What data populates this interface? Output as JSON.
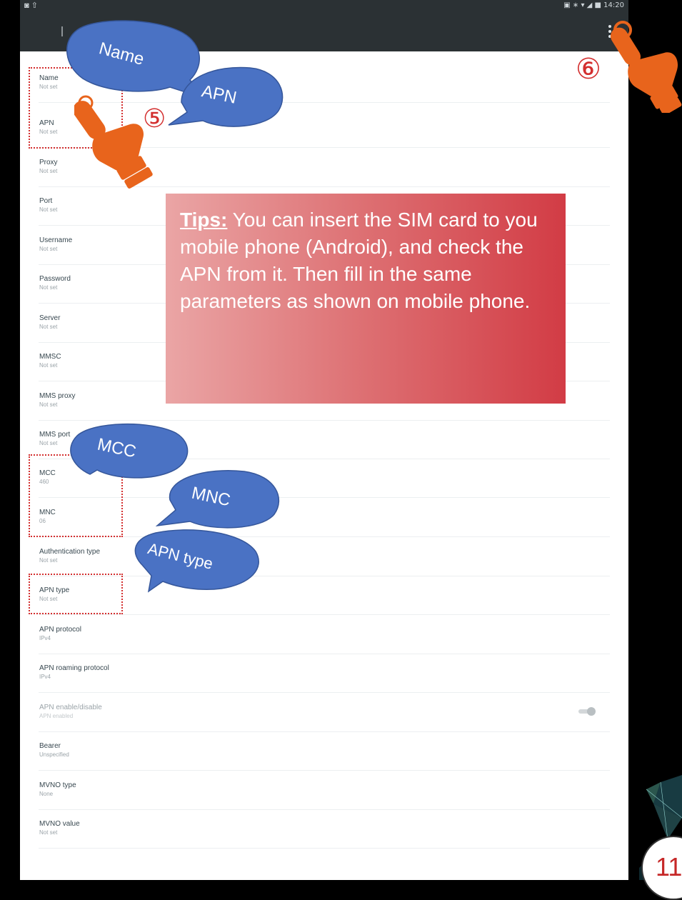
{
  "status_bar": {
    "left": "◙ ⇧",
    "right": "▣ ∗ ▾ ◢ ■ 14:20"
  },
  "fields": [
    {
      "label": "Name",
      "value": "Not set"
    },
    {
      "label": "APN",
      "value": "Not set"
    },
    {
      "label": "Proxy",
      "value": "Not set"
    },
    {
      "label": "Port",
      "value": "Not set"
    },
    {
      "label": "Username",
      "value": "Not set"
    },
    {
      "label": "Password",
      "value": "Not set"
    },
    {
      "label": "Server",
      "value": "Not set"
    },
    {
      "label": "MMSC",
      "value": "Not set"
    },
    {
      "label": "MMS proxy",
      "value": "Not set"
    },
    {
      "label": "MMS port",
      "value": "Not set"
    },
    {
      "label": "MCC",
      "value": "460"
    },
    {
      "label": "MNC",
      "value": "06"
    },
    {
      "label": "Authentication type",
      "value": "Not set"
    },
    {
      "label": "APN type",
      "value": "Not set"
    },
    {
      "label": "APN protocol",
      "value": "IPv4"
    },
    {
      "label": "APN roaming protocol",
      "value": "IPv4"
    },
    {
      "label": "APN enable/disable",
      "value": "APN enabled"
    },
    {
      "label": "Bearer",
      "value": "Unspecified"
    },
    {
      "label": "MVNO type",
      "value": "None"
    },
    {
      "label": "MVNO value",
      "value": "Not set"
    }
  ],
  "callouts": {
    "name": "Name",
    "apn": "APN",
    "mcc": "MCC",
    "mnc": "MNC",
    "apn_type": "APN type"
  },
  "steps": {
    "five": "⑤",
    "six": "⑥"
  },
  "tips": {
    "label": "Tips:",
    "text": " You can insert the SIM card to you mobile phone (Android), and check the APN from it. Then fill in the same parameters as shown on mobile phone."
  },
  "page_number": "11",
  "colors": {
    "bubble": "#4a72c4",
    "hand": "#e8641c",
    "highlight": "#d32f2f",
    "appbar": "#2b3134",
    "tips_gradient_start": "#eaa5a5",
    "tips_gradient_end": "#d23c45"
  },
  "icons": {
    "hand_pointer": "hand-pointer-icon",
    "overflow_menu": "more-vert-icon",
    "toggle": "toggle-switch"
  },
  "toggle_enabled": true
}
